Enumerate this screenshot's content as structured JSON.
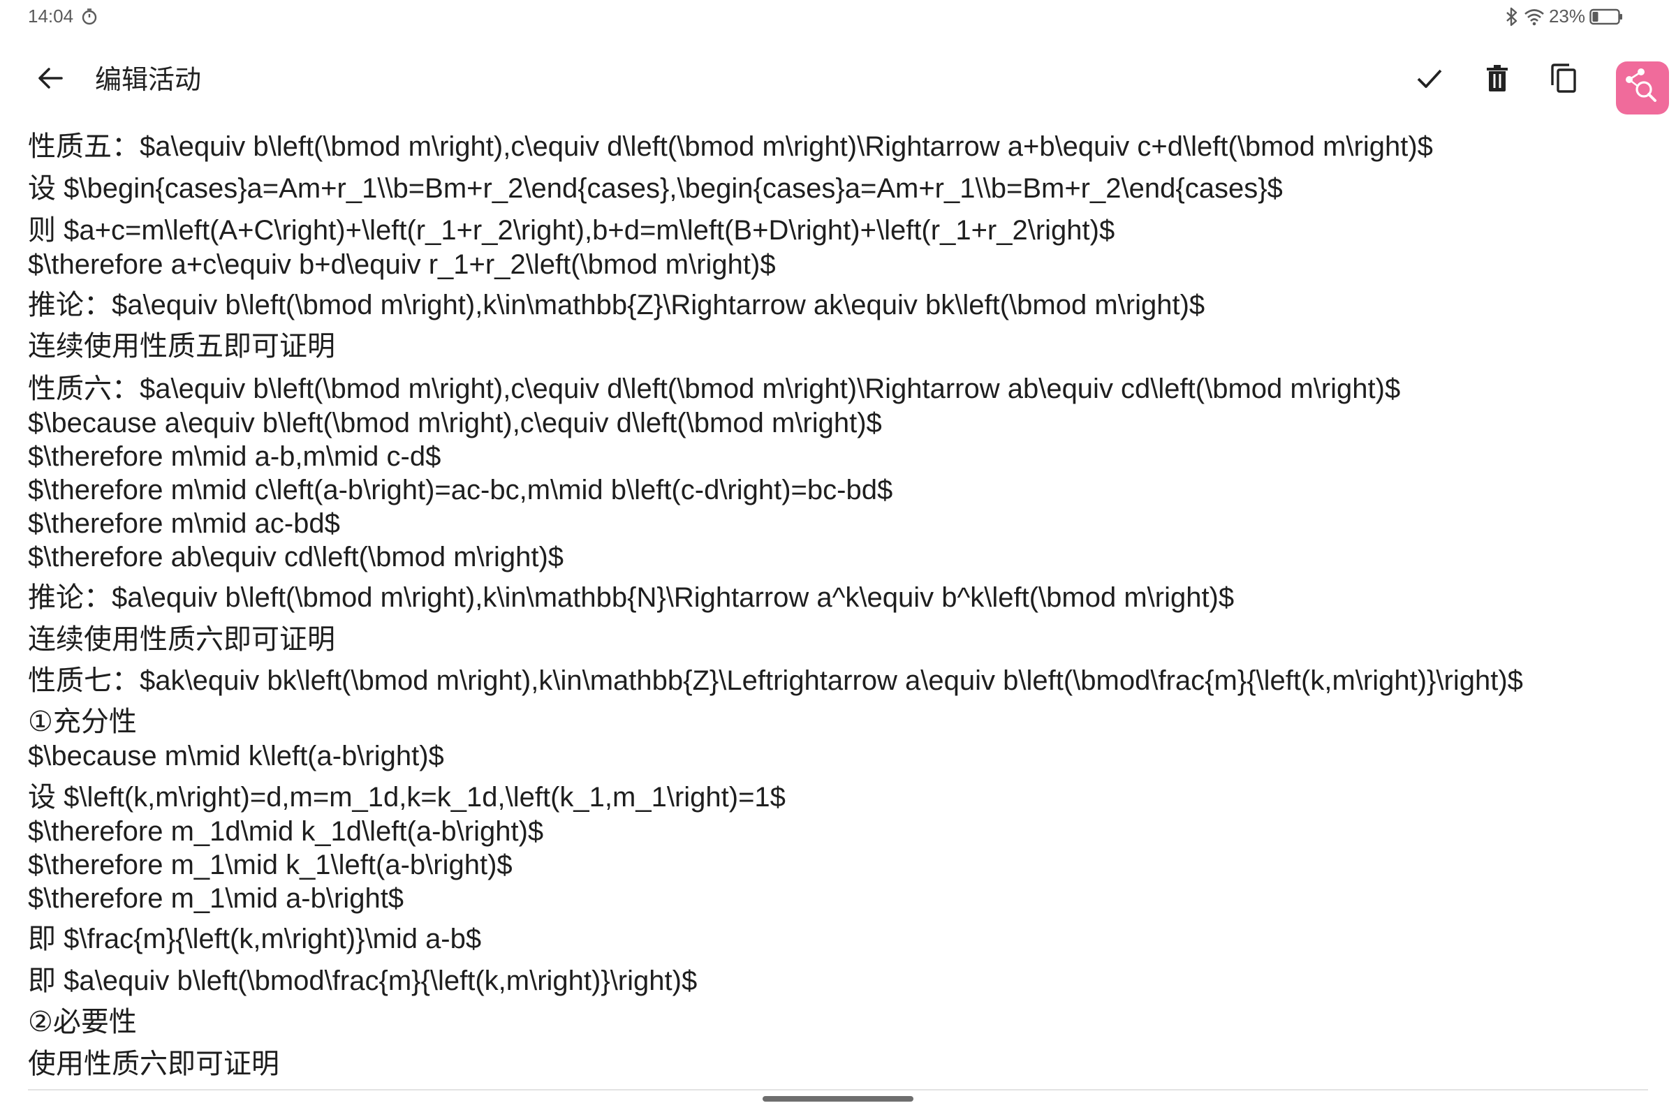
{
  "status_bar": {
    "time": "14:04",
    "battery": "23%",
    "icons": [
      "timer-icon",
      "bluetooth-icon",
      "wifi-icon",
      "battery-icon"
    ]
  },
  "app_bar": {
    "title": "编辑活动",
    "icons": [
      "back-arrow-icon",
      "check-icon",
      "delete-icon",
      "copy-icon",
      "share-search-icon"
    ],
    "accent_color": "#f06b9b"
  },
  "editor": {
    "lines": [
      "性质五：$a\\equiv b\\left(\\bmod m\\right),c\\equiv d\\left(\\bmod m\\right)\\Rightarrow a+b\\equiv c+d\\left(\\bmod m\\right)$",
      "设 $\\begin{cases}a=Am+r_1\\\\b=Bm+r_2\\end{cases},\\begin{cases}a=Am+r_1\\\\b=Bm+r_2\\end{cases}$",
      "则 $a+c=m\\left(A+C\\right)+\\left(r_1+r_2\\right),b+d=m\\left(B+D\\right)+\\left(r_1+r_2\\right)$",
      "$\\therefore a+c\\equiv b+d\\equiv r_1+r_2\\left(\\bmod m\\right)$",
      "推论：$a\\equiv b\\left(\\bmod m\\right),k\\in\\mathbb{Z}\\Rightarrow ak\\equiv bk\\left(\\bmod m\\right)$",
      "连续使用性质五即可证明",
      "性质六：$a\\equiv b\\left(\\bmod m\\right),c\\equiv d\\left(\\bmod m\\right)\\Rightarrow ab\\equiv cd\\left(\\bmod m\\right)$",
      "$\\because a\\equiv b\\left(\\bmod m\\right),c\\equiv d\\left(\\bmod m\\right)$",
      "$\\therefore m\\mid a-b,m\\mid c-d$",
      "$\\therefore m\\mid c\\left(a-b\\right)=ac-bc,m\\mid b\\left(c-d\\right)=bc-bd$",
      "$\\therefore m\\mid ac-bd$",
      "$\\therefore ab\\equiv cd\\left(\\bmod m\\right)$",
      "推论：$a\\equiv b\\left(\\bmod m\\right),k\\in\\mathbb{N}\\Rightarrow a^k\\equiv b^k\\left(\\bmod m\\right)$",
      "连续使用性质六即可证明",
      "性质七：$ak\\equiv bk\\left(\\bmod m\\right),k\\in\\mathbb{Z}\\Leftrightarrow a\\equiv b\\left(\\bmod\\frac{m}{\\left(k,m\\right)}\\right)$",
      "①充分性",
      "$\\because m\\mid k\\left(a-b\\right)$",
      "设 $\\left(k,m\\right)=d,m=m_1d,k=k_1d,\\left(k_1,m_1\\right)=1$",
      "$\\therefore m_1d\\mid k_1d\\left(a-b\\right)$",
      "$\\therefore m_1\\mid k_1\\left(a-b\\right)$",
      "$\\therefore m_1\\mid a-b\\right$",
      "即 $\\frac{m}{\\left(k,m\\right)}\\mid a-b$",
      "即 $a\\equiv b\\left(\\bmod\\frac{m}{\\left(k,m\\right)}\\right)$",
      "②必要性",
      "使用性质六即可证明"
    ]
  }
}
